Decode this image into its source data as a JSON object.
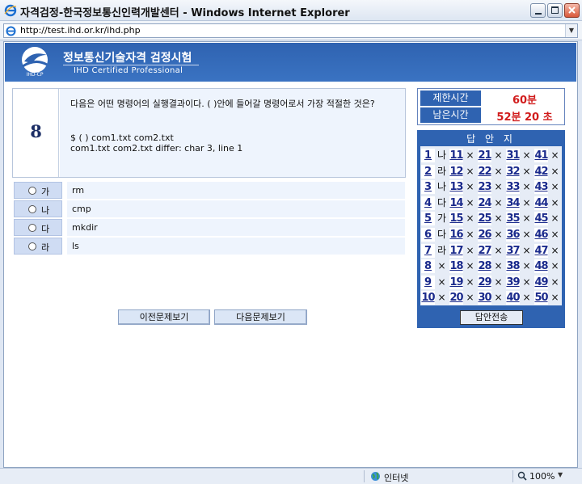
{
  "window": {
    "title": "자격검정-한국정보통신인력개발센터 - Windows Internet Explorer",
    "address": "http://test.ihd.or.kr/ihd.php"
  },
  "banner": {
    "title": "정보통신기술자격  검정시험",
    "subtitle": "IHD Certified Professional",
    "logo_text": "IHD-CP"
  },
  "question": {
    "number": "8",
    "text": "다음은 어떤 명령어의 실행결과이다. ( )안에 들어갈 명령어로서 가장 적절한 것은?",
    "code": "$ ( ) com1.txt com2.txt\ncom1.txt com2.txt differ: char 3, line 1"
  },
  "options": [
    {
      "letter": "가",
      "text": "rm"
    },
    {
      "letter": "나",
      "text": "cmp"
    },
    {
      "letter": "다",
      "text": "mkdir"
    },
    {
      "letter": "라",
      "text": "ls"
    }
  ],
  "nav": {
    "prev_label": "이전문제보기",
    "next_label": "다음문제보기"
  },
  "timer": {
    "limit_label": "제한시간",
    "limit_value": "60분",
    "remain_label": "남은시간",
    "remain_value": "52분 20 초"
  },
  "answer_sheet": {
    "title": "답 안 지",
    "submit_label": "답안전송",
    "items": [
      {
        "n": "1",
        "a": "나"
      },
      {
        "n": "2",
        "a": "라"
      },
      {
        "n": "3",
        "a": "나"
      },
      {
        "n": "4",
        "a": "다"
      },
      {
        "n": "5",
        "a": "가"
      },
      {
        "n": "6",
        "a": "다"
      },
      {
        "n": "7",
        "a": "라"
      },
      {
        "n": "8",
        "a": "×"
      },
      {
        "n": "9",
        "a": "×"
      },
      {
        "n": "10",
        "a": "×"
      },
      {
        "n": "11",
        "a": "×"
      },
      {
        "n": "12",
        "a": "×"
      },
      {
        "n": "13",
        "a": "×"
      },
      {
        "n": "14",
        "a": "×"
      },
      {
        "n": "15",
        "a": "×"
      },
      {
        "n": "16",
        "a": "×"
      },
      {
        "n": "17",
        "a": "×"
      },
      {
        "n": "18",
        "a": "×"
      },
      {
        "n": "19",
        "a": "×"
      },
      {
        "n": "20",
        "a": "×"
      },
      {
        "n": "21",
        "a": "×"
      },
      {
        "n": "22",
        "a": "×"
      },
      {
        "n": "23",
        "a": "×"
      },
      {
        "n": "24",
        "a": "×"
      },
      {
        "n": "25",
        "a": "×"
      },
      {
        "n": "26",
        "a": "×"
      },
      {
        "n": "27",
        "a": "×"
      },
      {
        "n": "28",
        "a": "×"
      },
      {
        "n": "29",
        "a": "×"
      },
      {
        "n": "30",
        "a": "×"
      },
      {
        "n": "31",
        "a": "×"
      },
      {
        "n": "32",
        "a": "×"
      },
      {
        "n": "33",
        "a": "×"
      },
      {
        "n": "34",
        "a": "×"
      },
      {
        "n": "35",
        "a": "×"
      },
      {
        "n": "36",
        "a": "×"
      },
      {
        "n": "37",
        "a": "×"
      },
      {
        "n": "38",
        "a": "×"
      },
      {
        "n": "39",
        "a": "×"
      },
      {
        "n": "40",
        "a": "×"
      },
      {
        "n": "41",
        "a": "×"
      },
      {
        "n": "42",
        "a": "×"
      },
      {
        "n": "43",
        "a": "×"
      },
      {
        "n": "44",
        "a": "×"
      },
      {
        "n": "45",
        "a": "×"
      },
      {
        "n": "46",
        "a": "×"
      },
      {
        "n": "47",
        "a": "×"
      },
      {
        "n": "48",
        "a": "×"
      },
      {
        "n": "49",
        "a": "×"
      },
      {
        "n": "50",
        "a": "×"
      }
    ]
  },
  "statusbar": {
    "zone": "인터넷",
    "zoom": "100%"
  },
  "colors": {
    "brand_blue": "#2f63b1",
    "timer_red": "#d11c1c",
    "link_navy": "#1a2a8c"
  }
}
